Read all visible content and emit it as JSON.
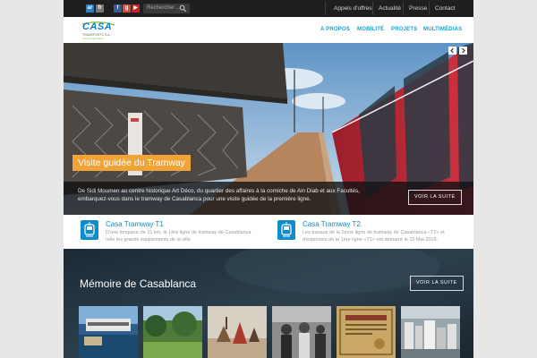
{
  "top_bar": {
    "languages": [
      "ar",
      "fr"
    ],
    "social": [
      "facebook-icon",
      "google-plus-icon",
      "youtube-icon"
    ],
    "search_placeholder": "Rechercher ...",
    "links": [
      "Appels d'offres",
      "Actualité",
      "Presse",
      "Contact"
    ]
  },
  "navbar": {
    "logo_text": "CASA",
    "logo_sub": "TRANSPORTS S.A.",
    "logo_tag": "Tous au quotidien",
    "items": [
      "A PROPOS",
      "MOBILITÉ",
      "PROJETS",
      "MULTIMÉDIAS"
    ]
  },
  "hero": {
    "title": "Visite guidée du Tramway",
    "text": "De Sidi Moumen au centre historique Art Déco, du quartier des affaires à la corniche de Ain Diab et aux Facultés, embarquez-vous dans le tramway de Casablanca pour une visite guidée de la première ligne.",
    "read_more": "VOIR LA SUITE"
  },
  "news": [
    {
      "title": "Casa Tramway T1",
      "desc": "D'une longueur de 31 km, la 1ère ligne de tramway de Casablanca relie les grands équipements de la ville"
    },
    {
      "title": "Casa Tramway T2",
      "desc": "Les travaux de la 2ème ligne de tramway de Casablanca «T2» et d'extension de la 1ère ligne «T1» ont démarré le 15 Mai 2015."
    }
  ],
  "memory": {
    "title": "Mémoire de Casablanca",
    "read_more": "VOIR LA SUITE"
  },
  "colors": {
    "accent_blue": "#16a1d6",
    "hero_title_bg": "#f0a337",
    "topbar_bg": "#1f1f21",
    "memory_bg": "#23323e"
  }
}
